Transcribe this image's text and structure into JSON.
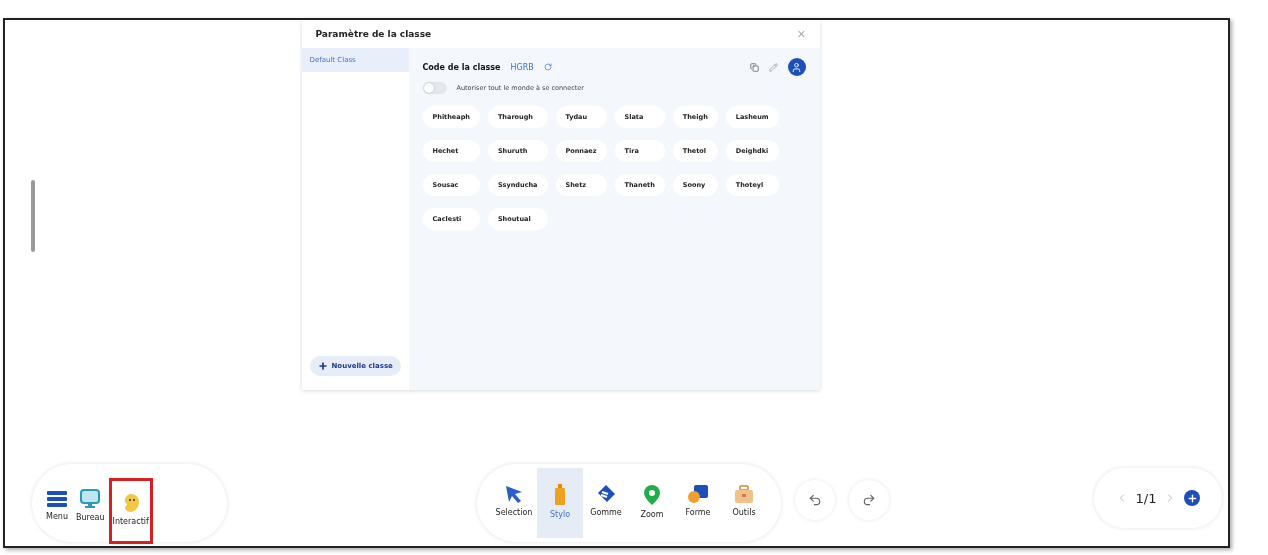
{
  "dialog": {
    "title": "Paramètre de la classe",
    "close": "×",
    "classes": [
      {
        "label": "Default Class",
        "selected": true
      }
    ],
    "new_class": "Nouvelle classe",
    "code_label": "Code de la classe",
    "code": "HGRB",
    "toggle": {
      "label": "Autoriser tout le monde à se connecter",
      "on": false
    },
    "students": [
      "Phitheaph",
      "Tharough",
      "Tydau",
      "Slata",
      "Theigh",
      "Lasheum",
      "Hechet",
      "Shuruth",
      "Ponnaez",
      "Tira",
      "Thetol",
      "Deighdki",
      "Sousac",
      "Ssynducha",
      "Shetz",
      "Thaneth",
      "Soony",
      "Thoteyl",
      "Caclesti",
      "Shoutual"
    ]
  },
  "dock": [
    {
      "kind": "menu",
      "label": "Menu",
      "highlighted": false
    },
    {
      "kind": "monitor",
      "label": "Bureau",
      "highlighted": false
    },
    {
      "kind": "smiley",
      "label": "Interactif",
      "highlighted": true
    }
  ],
  "tools": [
    {
      "kind": "cursor",
      "label": "Selection",
      "selected": false
    },
    {
      "kind": "pen",
      "label": "Stylo",
      "selected": true
    },
    {
      "kind": "eraser",
      "label": "Gomme",
      "selected": false
    },
    {
      "kind": "pin",
      "label": "Zoom",
      "selected": false
    },
    {
      "kind": "shapes",
      "label": "Forme",
      "selected": false
    },
    {
      "kind": "toolbox",
      "label": "Outils",
      "selected": false
    }
  ],
  "pager": {
    "page": "1/1"
  }
}
